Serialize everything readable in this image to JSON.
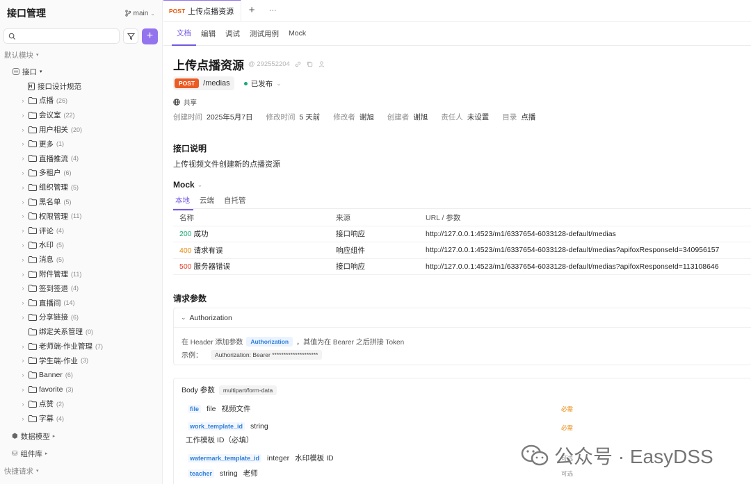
{
  "sidebar": {
    "title": "接口管理",
    "branch": "main",
    "search_placeholder": "",
    "section_label": "默认模块",
    "root_label": "接口",
    "doc_item": "接口设计规范",
    "folders": [
      {
        "label": "点播",
        "count": "(26)"
      },
      {
        "label": "会议室",
        "count": "(22)"
      },
      {
        "label": "用户相关",
        "count": "(20)"
      },
      {
        "label": "更多",
        "count": "(1)"
      },
      {
        "label": "直播推流",
        "count": "(4)"
      },
      {
        "label": "多租户",
        "count": "(6)"
      },
      {
        "label": "组织管理",
        "count": "(5)"
      },
      {
        "label": "黑名单",
        "count": "(5)"
      },
      {
        "label": "权限管理",
        "count": "(11)"
      },
      {
        "label": "评论",
        "count": "(4)"
      },
      {
        "label": "水印",
        "count": "(5)"
      },
      {
        "label": "消息",
        "count": "(5)"
      },
      {
        "label": "附件管理",
        "count": "(11)"
      },
      {
        "label": "签到签退",
        "count": "(4)"
      },
      {
        "label": "直播间",
        "count": "(14)"
      },
      {
        "label": "分享链接",
        "count": "(6)"
      },
      {
        "label": "绑定关系管理",
        "count": "(0)"
      },
      {
        "label": "老师端-作业管理",
        "count": "(7)"
      },
      {
        "label": "学生端-作业",
        "count": "(3)"
      },
      {
        "label": "Banner",
        "count": "(6)"
      },
      {
        "label": "favorite",
        "count": "(3)"
      },
      {
        "label": "点赞",
        "count": "(2)"
      },
      {
        "label": "字幕",
        "count": "(4)"
      }
    ],
    "data_model": "数据模型",
    "component_lib": "组件库",
    "quick_request": "快捷请求"
  },
  "topbar": {
    "tab_method": "POST",
    "tab_title": "上传点播资源",
    "add": "+",
    "more": "···"
  },
  "subtabs": [
    "文档",
    "编辑",
    "调试",
    "测试用例",
    "Mock"
  ],
  "api": {
    "title": "上传点播资源",
    "id": "292552204",
    "method": "POST",
    "path": "/medias",
    "status": "已发布",
    "share": "共享",
    "info": [
      {
        "label": "创建时间",
        "value": "2025年5月7日"
      },
      {
        "label": "修改时间",
        "value": "5 天前"
      },
      {
        "label": "修改者",
        "value": "谢旭"
      },
      {
        "label": "创建者",
        "value": "谢旭"
      },
      {
        "label": "责任人",
        "value": "未设置"
      },
      {
        "label": "目录",
        "value": "点播"
      }
    ],
    "desc_title": "接口说明",
    "desc": "上传视频文件创建新的点播资源"
  },
  "mock": {
    "title": "Mock",
    "tabs": [
      "本地",
      "云端",
      "自托管"
    ],
    "headers": [
      "名称",
      "来源",
      "URL / 参数"
    ],
    "rows": [
      {
        "code": "200",
        "name": "成功",
        "source": "接口响应",
        "url": "http://127.0.0.1:4523/m1/6337654-6033128-default/medias",
        "color": "#19a974"
      },
      {
        "code": "400",
        "name": "请求有误",
        "source": "响应组件",
        "url": "http://127.0.0.1:4523/m1/6337654-6033128-default/medias?apifoxResponseId=340956157",
        "color": "#e8890c"
      },
      {
        "code": "500",
        "name": "服务器错误",
        "source": "接口响应",
        "url": "http://127.0.0.1:4523/m1/6337654-6033128-default/medias?apifoxResponseId=113108646",
        "color": "#e0442b"
      }
    ]
  },
  "params": {
    "title": "请求参数",
    "auth": {
      "label": "Authorization",
      "line_prefix": "在 Header 添加参数",
      "chip": "Authorization",
      "line_suffix": "，其值为在 Bearer 之后拼接 Token",
      "example_label": "示例：",
      "example_value": "Authorization: Bearer ********************"
    },
    "body": {
      "label": "Body 参数",
      "type": "multipart/form-data",
      "items": [
        {
          "name": "file",
          "type": "file",
          "desc": "视频文件",
          "tag": "必需"
        },
        {
          "name": "work_template_id",
          "type": "string",
          "desc": "",
          "tag": "必需",
          "subdesc": "工作模板 ID（必填）"
        },
        {
          "name": "watermark_template_id",
          "type": "integer",
          "desc": "水印模板 ID",
          "tag": "可选"
        },
        {
          "name": "teacher",
          "type": "string",
          "desc": "老师",
          "tag": "可选"
        }
      ]
    }
  },
  "watermark": {
    "text": "公众号 · EasyDSS"
  }
}
